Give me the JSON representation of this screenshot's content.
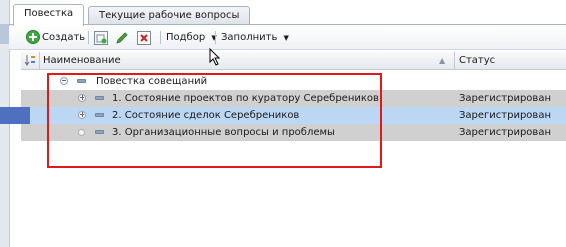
{
  "tabs": [
    {
      "label": "Повестка",
      "active": true
    },
    {
      "label": "Текущие рабочие вопросы",
      "active": false
    }
  ],
  "toolbar": {
    "create_label": "Создать",
    "select_label": "Подбор",
    "fill_label": "Заполнить",
    "icons": [
      "add-icon",
      "copy-icon",
      "edit-pencil-icon",
      "delete-icon",
      "dropdown-arrow-icon"
    ]
  },
  "grid": {
    "columns": [
      "Наименование",
      "Статус"
    ],
    "rows": [
      {
        "name": "Повестка совещаний",
        "status": "",
        "type": "group",
        "expander": "minus"
      },
      {
        "name": "1. Состояние проектов по куратору Серебреников",
        "status": "Зарегистрирован",
        "type": "item",
        "expander": "plus"
      },
      {
        "name": "2. Состояние сделок Серебреников",
        "status": "Зарегистрирован",
        "type": "item",
        "expander": "plus",
        "selected": true
      },
      {
        "name": "3. Организационные вопросы и проблемы",
        "status": "Зарегистрирован",
        "type": "item",
        "expander": "none"
      }
    ]
  },
  "colors": {
    "highlight": "#e01919",
    "selected_row": "#bcd7f3",
    "grey_row": "#d0d0d0"
  }
}
